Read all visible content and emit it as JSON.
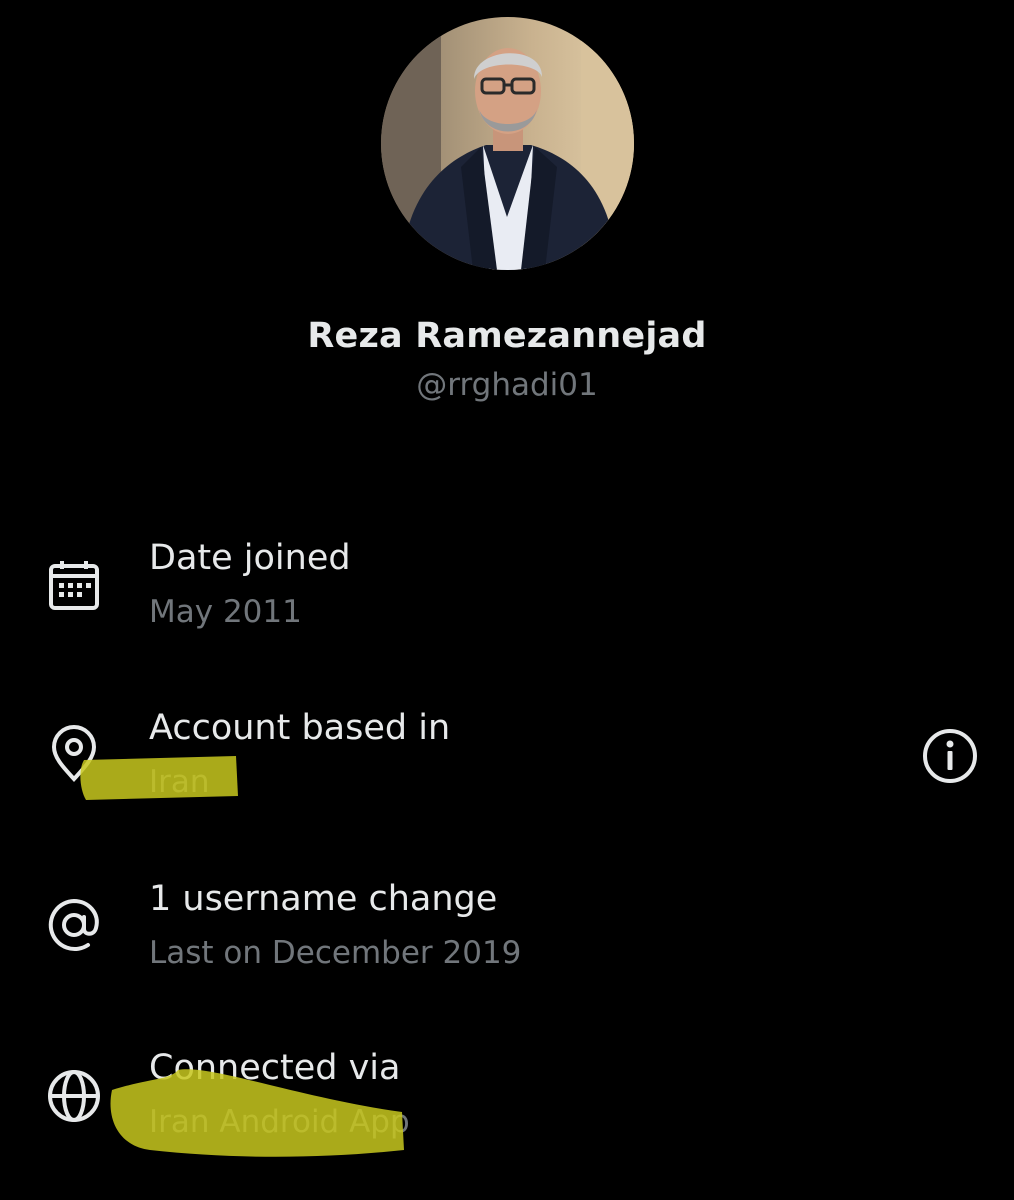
{
  "profile": {
    "name": "Reza Ramezannejad",
    "handle": "@rrghadi01"
  },
  "details": {
    "date_joined": {
      "label": "Date joined",
      "value": "May 2011",
      "icon": "calendar-icon"
    },
    "account_based_in": {
      "label": "Account based in",
      "value": "Iran",
      "icon": "location-pin-icon",
      "info_icon": "info-icon"
    },
    "username_change": {
      "label": "1 username change",
      "value": "Last on December 2019",
      "icon": "at-sign-icon"
    },
    "connected_via": {
      "label": "Connected via",
      "value": "Iran Android App",
      "icon": "globe-icon"
    }
  },
  "colors": {
    "background": "#000000",
    "primary_text": "#e7e9ea",
    "secondary_text": "#71767b",
    "highlighter": "#c8c81e"
  }
}
